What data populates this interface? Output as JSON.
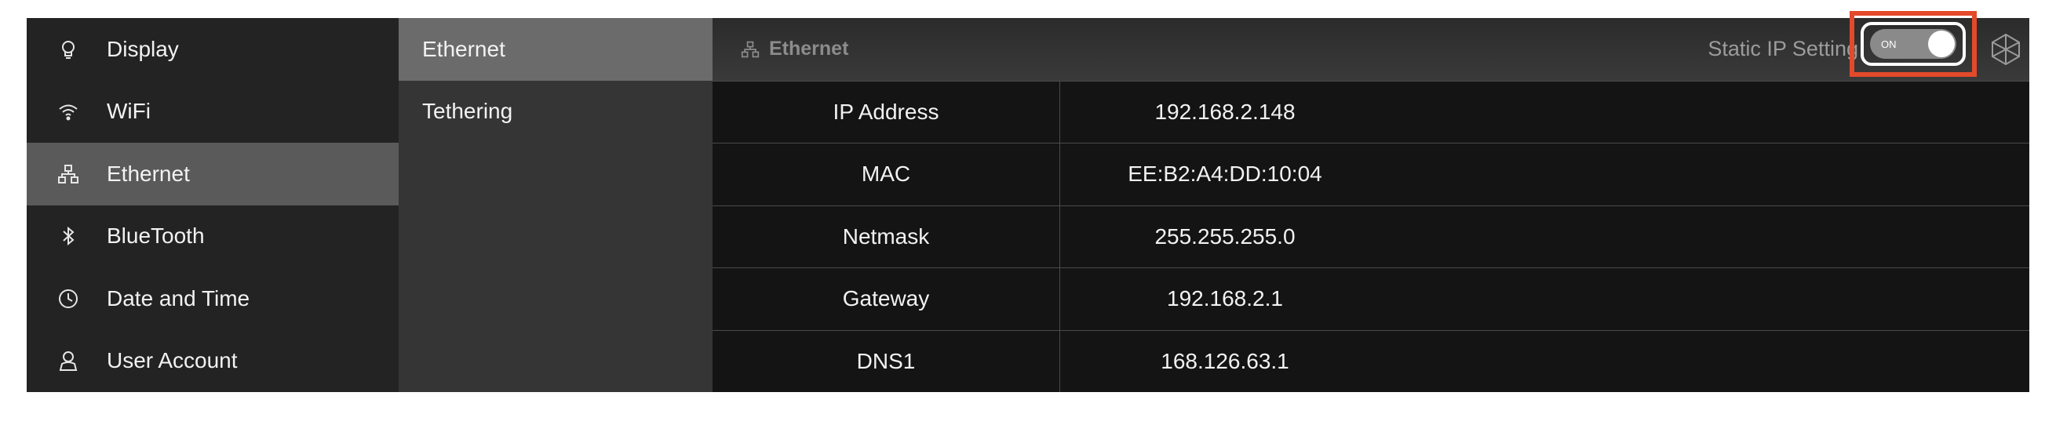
{
  "sidebar": {
    "items": [
      {
        "label": "Display",
        "icon": "bulb-icon"
      },
      {
        "label": "WiFi",
        "icon": "wifi-icon"
      },
      {
        "label": "Ethernet",
        "icon": "network-icon",
        "active": true
      },
      {
        "label": "BlueTooth",
        "icon": "bluetooth-icon"
      },
      {
        "label": "Date and Time",
        "icon": "clock-icon"
      },
      {
        "label": "User Account",
        "icon": "user-icon"
      }
    ]
  },
  "submenu": {
    "items": [
      {
        "label": "Ethernet",
        "active": true
      },
      {
        "label": "Tethering"
      }
    ]
  },
  "header": {
    "title": "Ethernet",
    "static_ip_label": "Static IP Setting",
    "toggle_text": "ON",
    "toggle_state": "on"
  },
  "details": [
    {
      "label": "IP Address",
      "value": "192.168.2.148"
    },
    {
      "label": "MAC",
      "value": "EE:B2:A4:DD:10:04"
    },
    {
      "label": "Netmask",
      "value": "255.255.255.0"
    },
    {
      "label": "Gateway",
      "value": "192.168.2.1"
    },
    {
      "label": "DNS1",
      "value": "168.126.63.1"
    }
  ],
  "colors": {
    "highlight_border": "#e24a2b",
    "active_sidebar": "#5a5a5a",
    "active_submenu": "#6b6b6b"
  }
}
